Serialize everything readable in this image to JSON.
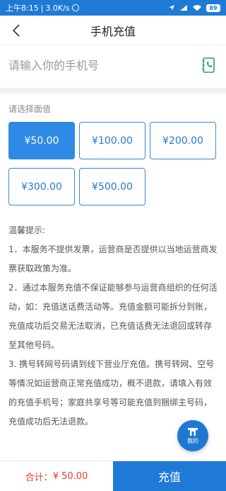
{
  "status_bar": {
    "time": "上午8:15",
    "speed": "3.0K/s",
    "battery": "89"
  },
  "nav": {
    "title": "手机充值"
  },
  "phone": {
    "placeholder": "请输入你的手机号",
    "value": ""
  },
  "amount_section": {
    "label": "请选择面值",
    "options": [
      "¥50.00",
      "¥100.00",
      "¥200.00",
      "¥300.00",
      "¥500.00"
    ],
    "selected": "¥50.00"
  },
  "tips": {
    "title": "温馨提示:",
    "items": [
      "1．本服务不提供发票，运营商是否提供以当地运营商发票获取政策为准。",
      "2．通过本服务充值不保证能够参与运营商组织的任何活动，如：充值送话费活动等。充值金额可能拆分到账，充值成功后交易无法取消，已充值话费无法退回或转存至其他号码。",
      "3. 携号转网号码请到线下营业厅充值。携号转网、空号等情况如运营商正常充值成功，概不退款，请填入有效的充值手机号；家庭共享号等可能充值到捆绑主号码，充值成功后无法退款。"
    ]
  },
  "fab": {
    "label": "我的",
    "icon": "shop-icon"
  },
  "bottom": {
    "total_label": "合计：",
    "total_value": "¥ 50.00",
    "pay_label": "充值"
  },
  "colors": {
    "primary": "#1f7ad6",
    "selected_bg": "#2e8ae4",
    "total_red": "#e53935",
    "contacts_green": "#2aa36b"
  }
}
